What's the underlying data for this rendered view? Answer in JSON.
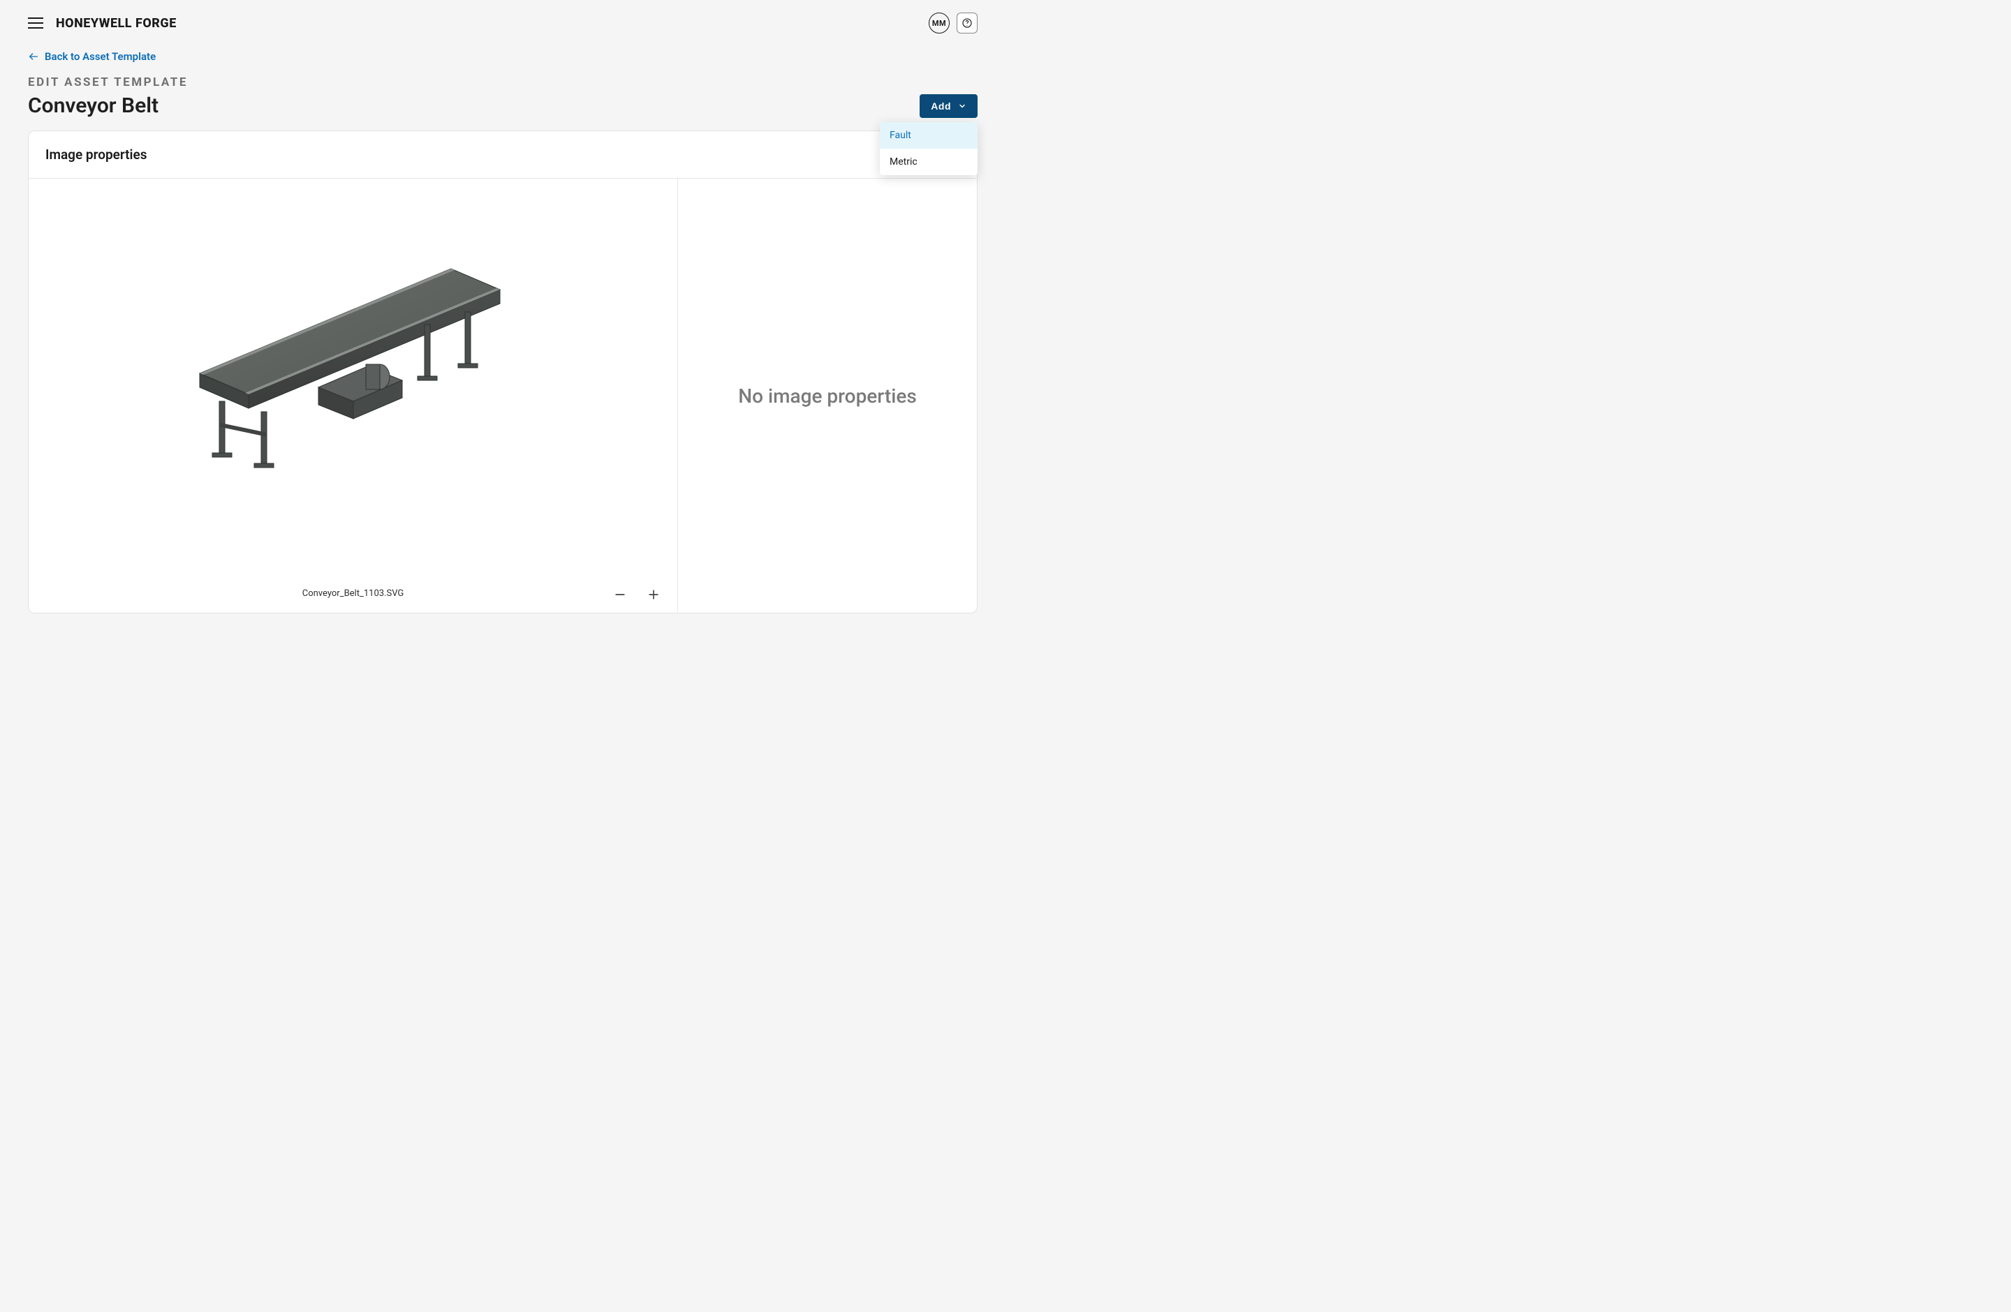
{
  "header": {
    "brand": "HONEYWELL FORGE",
    "avatar_initials": "MM"
  },
  "nav": {
    "back_label": "Back to Asset Template"
  },
  "page": {
    "eyebrow": "EDIT ASSET TEMPLATE",
    "title": "Conveyor Belt"
  },
  "actions": {
    "add_label": "Add",
    "dropdown": {
      "fault": "Fault",
      "metric": "Metric"
    }
  },
  "panel": {
    "title": "Image properties",
    "empty_message": "No image properties",
    "filename": "Conveyor_Belt_1103.SVG"
  }
}
